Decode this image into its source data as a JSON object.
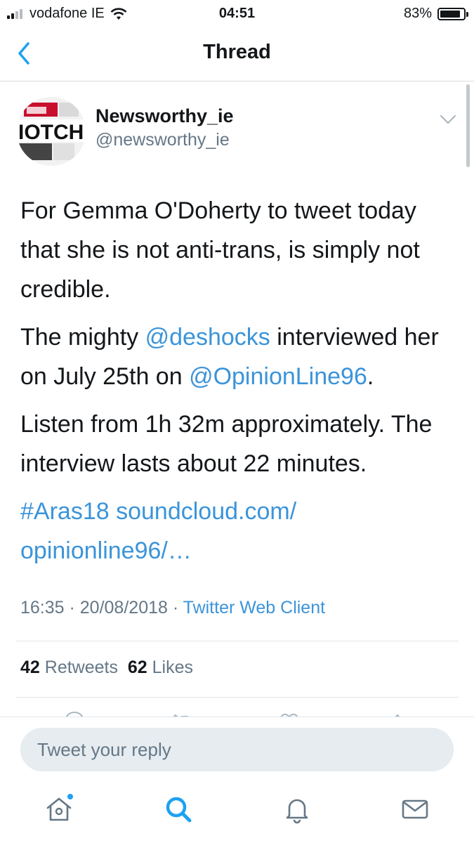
{
  "status_bar": {
    "carrier": "vodafone IE",
    "time": "04:51",
    "battery": "83%",
    "battery_level": 0.83,
    "signal_bars": 2
  },
  "nav": {
    "title": "Thread"
  },
  "tweet": {
    "display_name": "Newsworthy_ie",
    "handle": "@newsworthy_ie",
    "para1": "For Gemma O'Doherty to tweet today that she is not anti-trans, is simply not credible.",
    "para2_a": "The mighty ",
    "para2_mention1": "@deshocks",
    "para2_b": " interviewed her on July 25th on ",
    "para2_mention2": "@OpinionLine96",
    "para2_c": ".",
    "para3": "Listen from 1h 32m approximately. The interview lasts about 22 minutes.",
    "hashtag": "#Aras18",
    "link": "soundcloud.com/ opinionline96/…",
    "timestamp": "16:35 · 20/08/2018 · ",
    "client": "Twitter Web Client",
    "retweets_count": "42",
    "retweets_label": " Retweets",
    "likes_count": "62",
    "likes_label": " Likes"
  },
  "reply": {
    "placeholder": "Tweet your reply"
  },
  "colors": {
    "accent": "#1da1f2",
    "link": "#3b94d9",
    "secondary_text": "#657786",
    "input_bg": "#e6ecf0"
  },
  "tabs": [
    {
      "icon": "home-icon"
    },
    {
      "icon": "search-icon"
    },
    {
      "icon": "bell-icon"
    },
    {
      "icon": "mail-icon"
    }
  ]
}
